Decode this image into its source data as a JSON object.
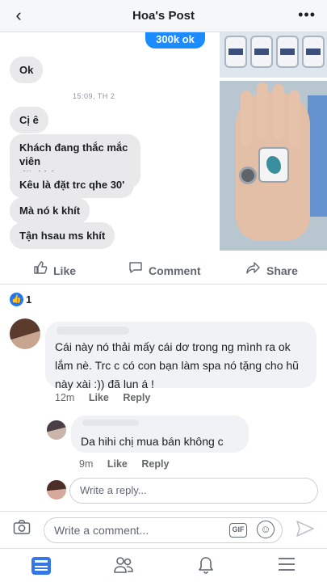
{
  "header": {
    "title": "Hoa's Post",
    "back_icon": "‹",
    "more_icon": "•••"
  },
  "post_image": {
    "chat": {
      "sent_message": "300k ok",
      "received": [
        "Ok",
        "Cị ê",
        "Khách đang thắc mắc viên\nđặt khí*",
        "Kêu là đặt trc qhe 30'",
        "Mà nó k khít",
        "Tận hsau ms khít"
      ],
      "timestamp": "15:09, TH 2"
    }
  },
  "actions": {
    "like_label": "Like",
    "comment_label": "Comment",
    "share_label": "Share"
  },
  "reactions": {
    "count": "1",
    "icon": "like-icon",
    "icon_glyph": "👍"
  },
  "comments": [
    {
      "text": "Cái này nó thải mấy cái dơ trong ng mình ra ok lắm nè. Trc c có con bạn làm spa nó tặng cho hũ này xài :)) đã lun á !",
      "time": "12m",
      "like_label": "Like",
      "reply_label": "Reply"
    }
  ],
  "replies": [
    {
      "text": "Da hihi chị mua bán không c",
      "time": "9m",
      "like_label": "Like",
      "reply_label": "Reply"
    }
  ],
  "reply_input": {
    "placeholder": "Write a reply..."
  },
  "comment_bar": {
    "placeholder": "Write a comment...",
    "gif_label": "GIF"
  },
  "colors": {
    "accent": "#1877f2",
    "sent_bubble": "#1a8cff",
    "received_bubble": "#e9e9ec",
    "comment_bubble": "#f0f2f5",
    "muted_text": "#65676b"
  }
}
